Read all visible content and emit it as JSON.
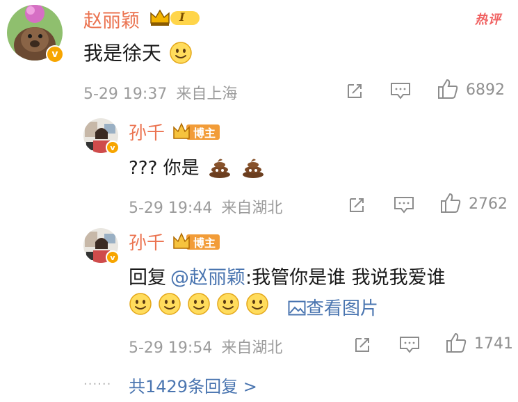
{
  "hot_label": "热评",
  "main_comment": {
    "author": "赵丽颖",
    "level": "I",
    "text": "我是徐天",
    "date": "5-29 19:37",
    "location": "来自上海",
    "likes": "6892"
  },
  "replies": [
    {
      "author": "孙千",
      "badge": "博主",
      "text": "??? 你是",
      "date": "5-29 19:44",
      "location": "来自湖北",
      "likes": "2762"
    },
    {
      "author": "孙千",
      "badge": "博主",
      "reply_prefix": "回复",
      "mention": "@赵丽颖",
      "text": ":我管你是谁 我说我爱谁",
      "view_image": "查看图片",
      "date": "5-29 19:54",
      "location": "来自湖北",
      "likes": "1741"
    }
  ],
  "more_replies": "共1429条回复 >",
  "colors": {
    "name": "#eb7350",
    "link": "#4a75b0",
    "hot": "#f06161",
    "meta": "#9b9b9b"
  }
}
